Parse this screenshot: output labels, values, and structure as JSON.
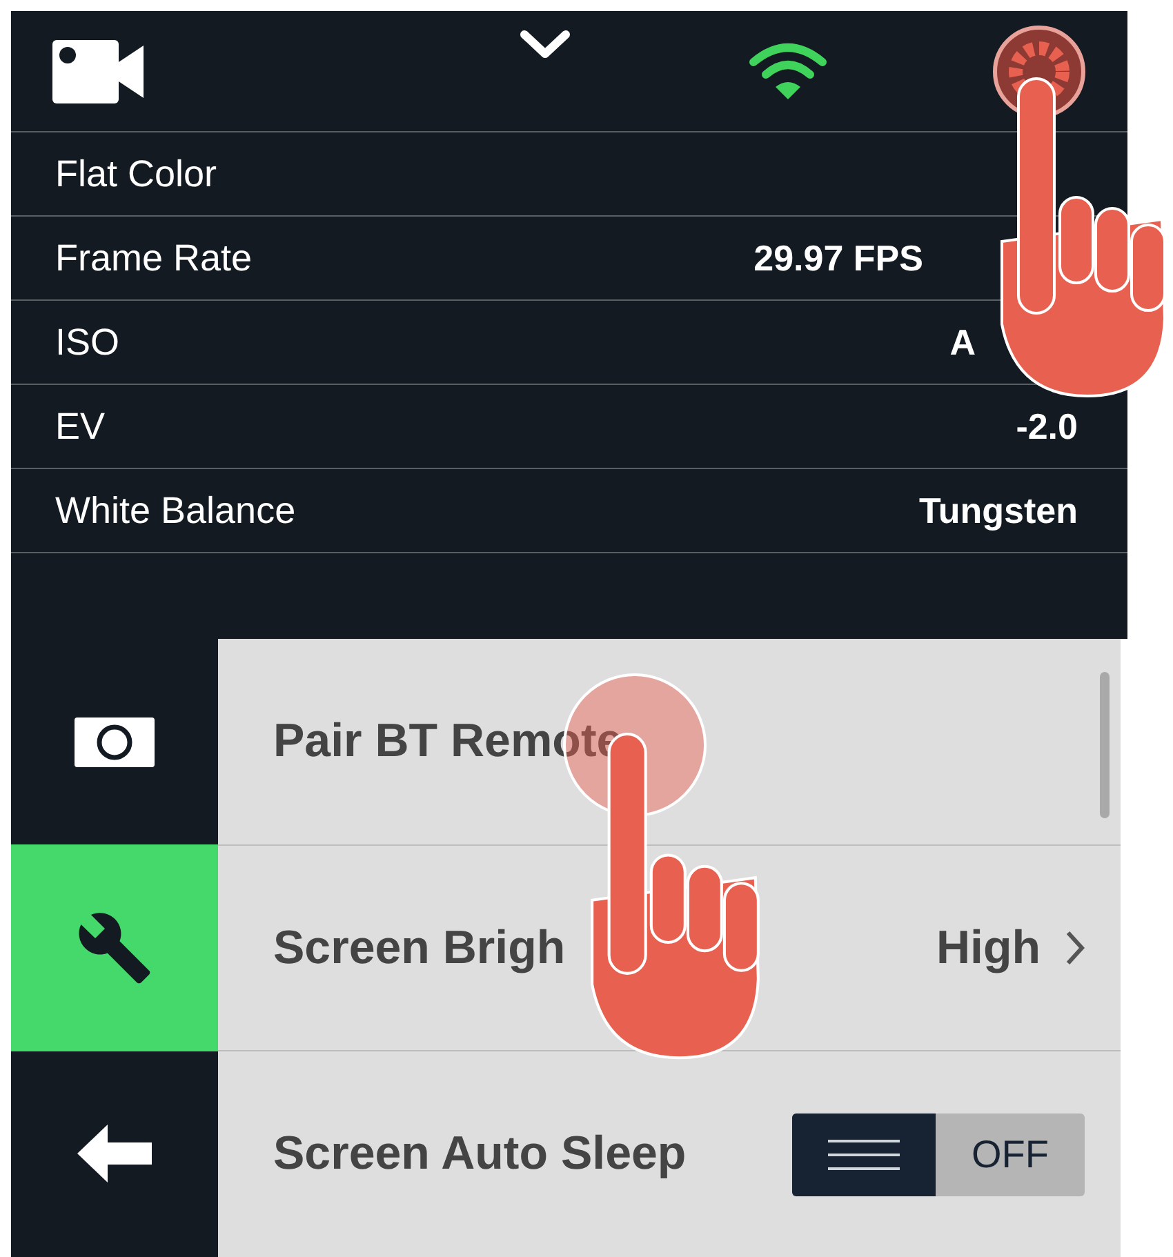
{
  "camera_screen": {
    "rows": [
      {
        "label": "Flat Color"
      },
      {
        "label": "Frame Rate",
        "value": "29.97 FPS"
      },
      {
        "label": "ISO",
        "value": "A"
      },
      {
        "label": "EV",
        "value": "-2.0"
      },
      {
        "label": "White Balance",
        "value": "Tungsten"
      }
    ]
  },
  "settings_screen": {
    "sidebar": [
      {
        "kind": "camera",
        "selected": false
      },
      {
        "kind": "wrench",
        "selected": true
      },
      {
        "kind": "back",
        "selected": false
      }
    ],
    "menu": [
      {
        "kind": "plain",
        "label": "Pair BT Remote"
      },
      {
        "kind": "value",
        "label": "Screen Brigh",
        "value": "High"
      },
      {
        "kind": "toggle",
        "label": "Screen Auto Sleep",
        "on": false,
        "state_label": "OFF"
      }
    ]
  }
}
